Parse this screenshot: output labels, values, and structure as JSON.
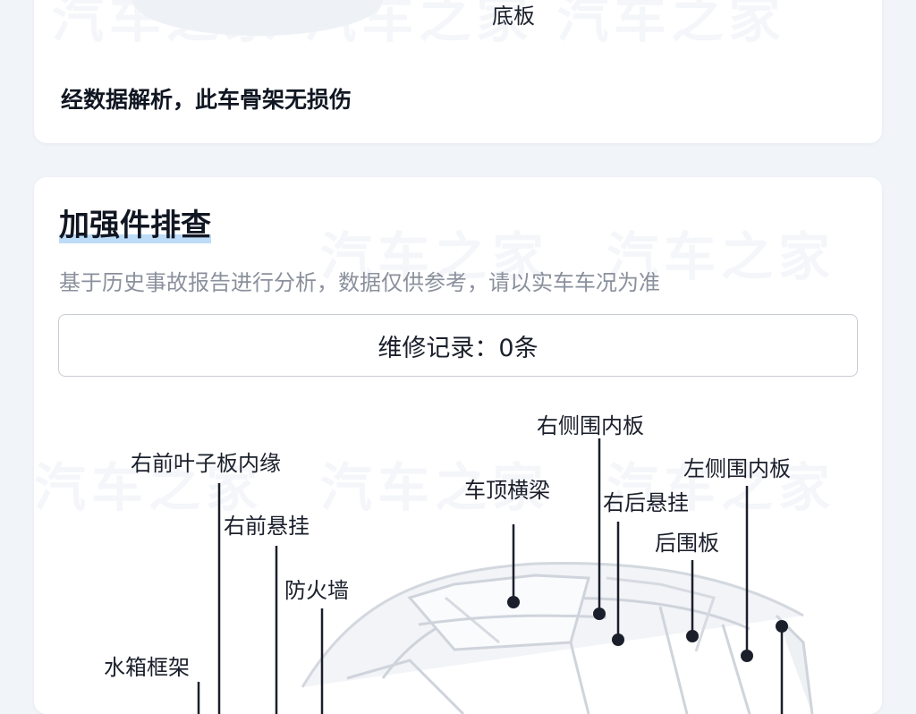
{
  "top_card": {
    "bottom_label": "底板",
    "result_text": "经数据解析，此车骨架无损伤"
  },
  "reinforcement": {
    "title": "加强件排查",
    "subtitle": "基于历史事故报告进行分析，数据仅供参考，请以实车车况为准",
    "records_label": "维修记录：0条"
  },
  "parts": {
    "right_side_inner": "右侧围内板",
    "left_side_inner": "左侧围内板",
    "right_front_fender_inner": "右前叶子板内缘",
    "roof_crossbeam": "车顶横梁",
    "right_rear_suspension": "右后悬挂",
    "right_front_suspension": "右前悬挂",
    "rear_panel": "后围板",
    "firewall": "防火墙",
    "radiator_frame": "水箱框架"
  },
  "colors": {
    "page_bg": "#f1f4f9",
    "card_bg": "#ffffff",
    "title_highlight": "#bcdcf8",
    "subtitle_text": "#8a909c",
    "marker": "#1a1f2b"
  }
}
